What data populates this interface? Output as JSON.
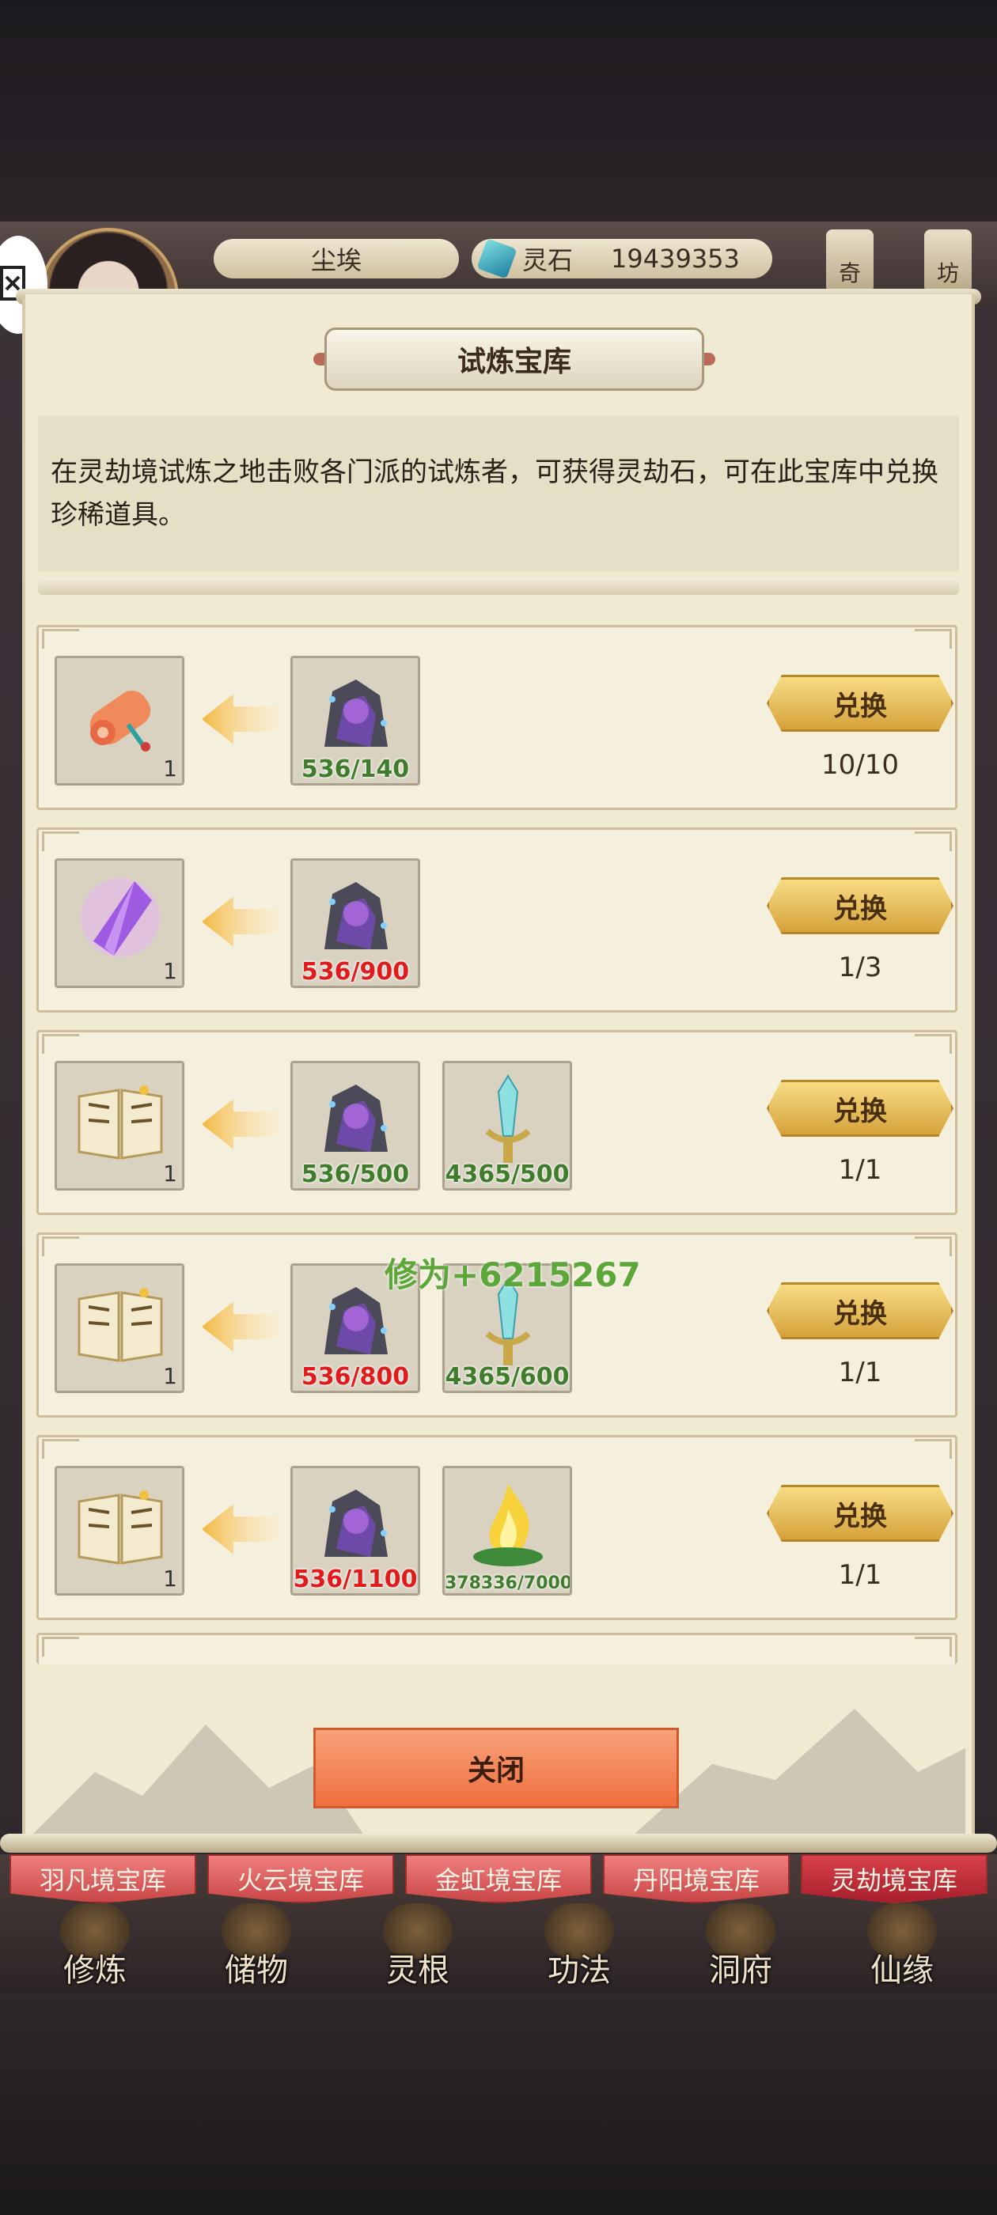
{
  "player": {
    "name": "尘埃",
    "currency_label": "灵石",
    "currency_value": "19439353",
    "side_tabs": [
      "奇",
      "坊"
    ]
  },
  "panel": {
    "title": "试炼宝库",
    "description": "在灵劫境试炼之地击败各门派的试炼者，可获得灵劫石，可在此宝库中兑换珍稀道具。",
    "exchange_label": "兑换",
    "close_label": "关闭"
  },
  "items": [
    {
      "reward_icon": "scroll-icon",
      "reward_qty": "1",
      "costs": [
        {
          "icon": "lingjie-stone-icon",
          "text": "536/140",
          "color": "green"
        }
      ],
      "limit": "10/10"
    },
    {
      "reward_icon": "purple-crystal-icon",
      "reward_qty": "1",
      "costs": [
        {
          "icon": "lingjie-stone-icon",
          "text": "536/900",
          "color": "red"
        }
      ],
      "limit": "1/3"
    },
    {
      "reward_icon": "skill-book-icon",
      "reward_qty": "1",
      "costs": [
        {
          "icon": "lingjie-stone-icon",
          "text": "536/500",
          "color": "green"
        },
        {
          "icon": "jade-sword-icon",
          "text": "4365/500",
          "color": "green"
        }
      ],
      "limit": "1/1"
    },
    {
      "reward_icon": "skill-book-icon",
      "reward_qty": "1",
      "costs": [
        {
          "icon": "lingjie-stone-icon",
          "text": "536/800",
          "color": "red"
        },
        {
          "icon": "jade-sword-icon",
          "text": "4365/600",
          "color": "green"
        }
      ],
      "limit": "1/1"
    },
    {
      "reward_icon": "skill-book-icon",
      "reward_qty": "1",
      "costs": [
        {
          "icon": "lingjie-stone-icon",
          "text": "536/1100",
          "color": "red"
        },
        {
          "icon": "golden-flame-icon",
          "text": "378336/7000",
          "color": "green",
          "small": true
        }
      ],
      "limit": "1/1"
    }
  ],
  "float_text": "修为+6215267",
  "vault_tabs": [
    {
      "label": "羽凡境宝库",
      "active": false
    },
    {
      "label": "火云境宝库",
      "active": false
    },
    {
      "label": "金虹境宝库",
      "active": false
    },
    {
      "label": "丹阳境宝库",
      "active": false
    },
    {
      "label": "灵劫境宝库",
      "active": true
    }
  ],
  "bottom_nav": [
    "修炼",
    "储物",
    "灵根",
    "功法",
    "洞府",
    "仙缘"
  ],
  "colors": {
    "green": "#3f7d2c",
    "red": "#e11b1b",
    "gold": "#f0c75a",
    "close_orange": "#f08050"
  }
}
